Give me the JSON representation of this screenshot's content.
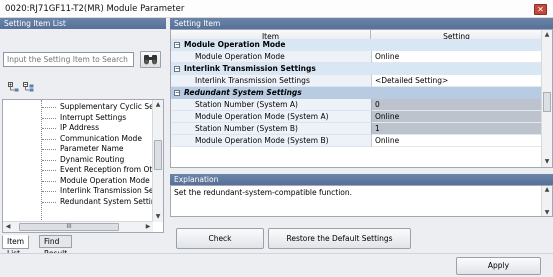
{
  "window": {
    "title": "0020:RJ71GF11-T2(MR) Module Parameter",
    "close_glyph": "✕"
  },
  "left": {
    "header": "Setting Item List",
    "search": {
      "placeholder": "Input the Setting Item to Search",
      "value": ""
    },
    "search_icon": "binoculars-icon",
    "toolbar_icons": [
      "expand-all-icon",
      "collapse-all-icon"
    ],
    "tree": [
      {
        "label": "Supplementary Cyclic Set",
        "selected": false
      },
      {
        "label": "Interrupt Settings",
        "selected": false
      },
      {
        "label": "IP Address",
        "selected": false
      },
      {
        "label": "Communication Mode",
        "selected": false
      },
      {
        "label": "Parameter Name",
        "selected": false
      },
      {
        "label": "Dynamic Routing",
        "selected": false
      },
      {
        "label": "Event Reception from Oth",
        "selected": false
      },
      {
        "label": "Module Operation Mode",
        "selected": false
      },
      {
        "label": "Interlink Transmission Se",
        "selected": false
      },
      {
        "label": "Redundant System Settin",
        "selected": true
      }
    ],
    "hscroll_thumb_label": "III",
    "tabs": [
      {
        "label": "Item List",
        "active": true
      },
      {
        "label": "Find Result",
        "active": false
      }
    ]
  },
  "right": {
    "header": "Setting Item",
    "columns": {
      "item": "Item",
      "setting": "Setting"
    },
    "rows": [
      {
        "type": "group",
        "expander": "−",
        "item": "Module Operation Mode",
        "setting": "",
        "top": true
      },
      {
        "type": "item",
        "item": "Module Operation Mode",
        "setting": "Online",
        "dim": false
      },
      {
        "type": "group",
        "expander": "−",
        "item": "Interlink Transmission Settings",
        "setting": ""
      },
      {
        "type": "item",
        "item": "Interlink Transmission Settings",
        "setting": "<Detailed Setting>",
        "dim": false
      },
      {
        "type": "group",
        "expander": "−",
        "item": "Redundant System Settings",
        "setting": "",
        "selected": true
      },
      {
        "type": "item",
        "item": "Station Number (System A)",
        "setting": "0",
        "dim": true
      },
      {
        "type": "item",
        "item": "Module Operation Mode (System A)",
        "setting": "Online",
        "dim": true
      },
      {
        "type": "item",
        "item": "Station Number (System B)",
        "setting": "1",
        "dim": true
      },
      {
        "type": "item",
        "item": "Module Operation Mode (System B)",
        "setting": "Online",
        "dim": false
      }
    ],
    "explanation_header": "Explanation",
    "explanation_text": "Set the redundant-system-compatible function.",
    "buttons": {
      "check": "Check",
      "restore": "Restore the Default Settings"
    }
  },
  "footer": {
    "apply": "Apply"
  }
}
